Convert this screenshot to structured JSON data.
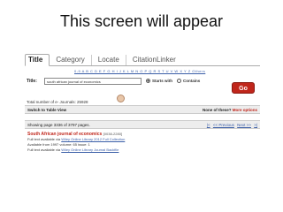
{
  "slide": {
    "heading": "This screen will appear"
  },
  "tabs": [
    "Title",
    "Category",
    "Locate",
    "CitationLinker"
  ],
  "letters": "0-9 A B C D E F G H I J K L M N O P Q R S T U V W X Y Z Others",
  "search": {
    "label": "Title:",
    "value": "south african journal of economics",
    "opt1": "Starts with",
    "opt2": "Contains",
    "go": "Go"
  },
  "totals": "Total number of e- Journals: 25928",
  "switch": {
    "left": "Switch to Table View",
    "right_q": "None of these?",
    "right_link": "More options"
  },
  "paging": {
    "text": "Showing page 3336 of 3797 pages.",
    "first": "|<",
    "prev": "<< Previous",
    "next": "Next >>",
    "last": ">|"
  },
  "result": {
    "title": "South African journal of economics",
    "issn": "[0038-2280]",
    "line1_prefix": "Full text available via",
    "line1_link": "Wiley Online Library 2012 Full Collection",
    "line2": "Available from 1997 volume: 65 issue: 1",
    "line3_prefix": "Full text available via",
    "line3_link": "Wiley Online Library Journal Backfile"
  }
}
